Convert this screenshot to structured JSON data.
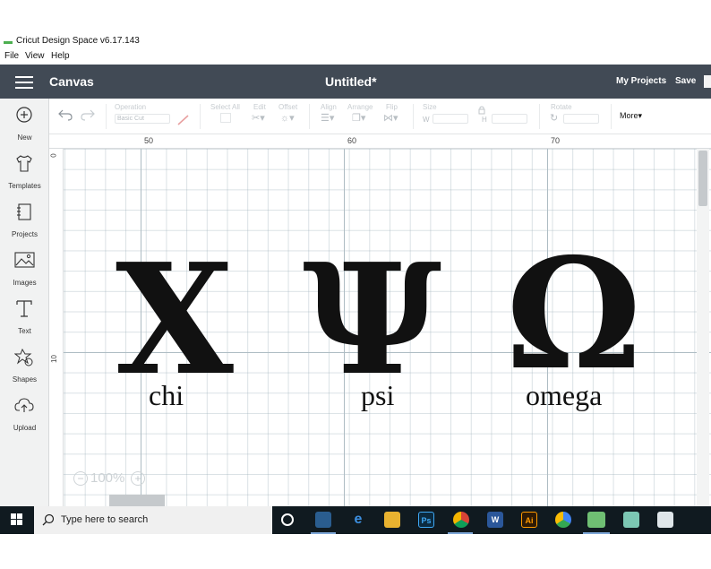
{
  "window": {
    "app_title": "Cricut Design Space  v6.17.143"
  },
  "menu": [
    "File",
    "View",
    "Help"
  ],
  "header": {
    "section": "Canvas",
    "doc_title": "Untitled*",
    "my_projects": "My Projects",
    "save": "Save"
  },
  "sidebar": {
    "items": [
      {
        "label": "New",
        "icon": "plus-circle-icon"
      },
      {
        "label": "Templates",
        "icon": "tshirt-icon"
      },
      {
        "label": "Projects",
        "icon": "notebook-icon"
      },
      {
        "label": "Images",
        "icon": "image-icon"
      },
      {
        "label": "Text",
        "icon": "text-icon"
      },
      {
        "label": "Shapes",
        "icon": "shapes-icon"
      },
      {
        "label": "Upload",
        "icon": "upload-icon"
      }
    ]
  },
  "toolbar": {
    "operation_label": "Operation",
    "operation_value": "Basic Cut",
    "select_all": "Select All",
    "edit": "Edit",
    "offset": "Offset",
    "align": "Align",
    "arrange": "Arrange",
    "flip": "Flip",
    "size": "Size",
    "w": "W",
    "h": "H",
    "rotate": "Rotate",
    "more": "More"
  },
  "ruler": {
    "top": [
      "50",
      "60",
      "70"
    ],
    "left": [
      "0",
      "10"
    ]
  },
  "canvas": {
    "symbols": [
      {
        "glyph": "Χ",
        "name": "chi"
      },
      {
        "glyph": "Ψ",
        "name": "psi"
      },
      {
        "glyph": "Ω",
        "name": "omega"
      }
    ],
    "zoom": "100%",
    "zoom_out": "−",
    "zoom_in": "+"
  },
  "taskbar": {
    "search_placeholder": "Type here to search",
    "apps": [
      "cortana-icon",
      "explorer-icon",
      "edge-icon",
      "files-icon",
      "photoshop-icon",
      "chrome-icon",
      "word-icon",
      "illustrator-icon",
      "chrome-alt-icon",
      "cricut-icon",
      "app-icon",
      "photos-icon"
    ],
    "ps_text": "Ps",
    "word_text": "W",
    "ai_text": "Ai"
  }
}
